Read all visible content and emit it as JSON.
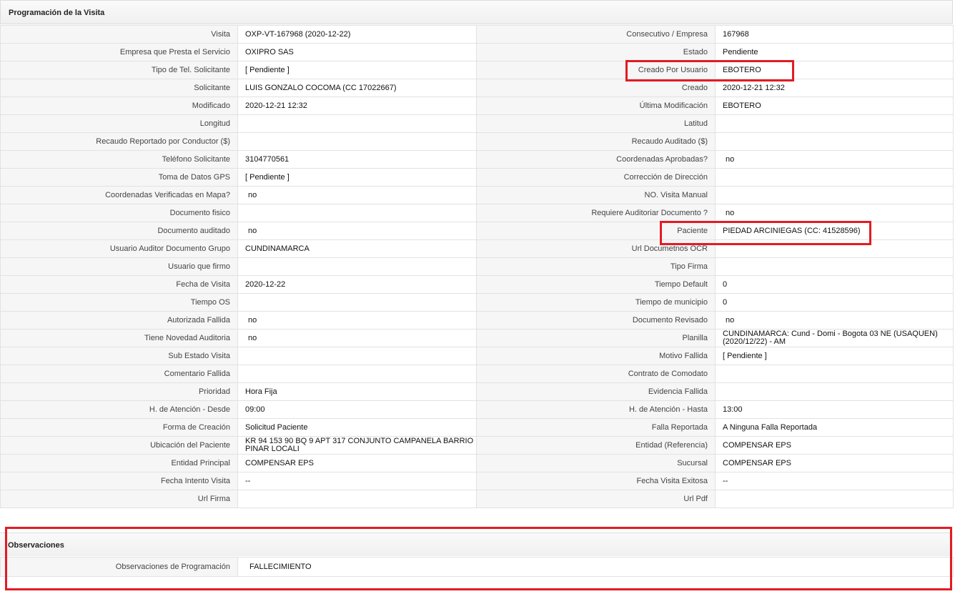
{
  "section_title": "Programación de la Visita",
  "rows": [
    {
      "l1": "Visita",
      "v1": "OXP-VT-167968 (2020-12-22)",
      "l2": "Consecutivo / Empresa",
      "v2": "167968"
    },
    {
      "l1": "Empresa que Presta el Servicio",
      "v1": "OXIPRO SAS",
      "l2": "Estado",
      "v2": "Pendiente"
    },
    {
      "l1": "Tipo de Tel. Solicitante",
      "v1": "[ Pendiente ]",
      "l2": "Creado Por Usuario",
      "v2": "EBOTERO"
    },
    {
      "l1": "Solicitante",
      "v1": "LUIS GONZALO COCOMA (CC 17022667)",
      "l2": "Creado",
      "v2": "2020-12-21 12:32"
    },
    {
      "l1": "Modificado",
      "v1": "2020-12-21 12:32",
      "l2": "Última Modificación",
      "v2": "EBOTERO"
    },
    {
      "l1": "Longitud",
      "v1": "",
      "l2": "Latitud",
      "v2": ""
    },
    {
      "l1": "Recaudo Reportado por Conductor ($)",
      "v1": "",
      "l2": "Recaudo Auditado ($)",
      "v2": ""
    },
    {
      "l1": "Teléfono Solicitante",
      "v1": "3104770561",
      "l2": "Coordenadas Aprobadas?",
      "v2": "no"
    },
    {
      "l1": "Toma de Datos GPS",
      "v1": "[ Pendiente ]",
      "l2": "Corrección de Dirección",
      "v2": ""
    },
    {
      "l1": "Coordenadas Verificadas en Mapa?",
      "v1": "no",
      "l2": "NO. Visita Manual",
      "v2": ""
    },
    {
      "l1": "Documento fisico",
      "v1": "",
      "l2": "Requiere Auditoriar Documento ?",
      "v2": "no"
    },
    {
      "l1": "Documento auditado",
      "v1": "no",
      "l2": "Paciente",
      "v2": "PIEDAD ARCINIEGAS (CC: 41528596)"
    },
    {
      "l1": "Usuario Auditor Documento Grupo",
      "v1": "CUNDINAMARCA",
      "l2": "Url Documetnos OCR",
      "v2": ""
    },
    {
      "l1": "Usuario que firmo",
      "v1": "",
      "l2": "Tipo Firma",
      "v2": ""
    },
    {
      "l1": "Fecha de Visita",
      "v1": "2020-12-22",
      "l2": "Tiempo Default",
      "v2": "0"
    },
    {
      "l1": "Tiempo OS",
      "v1": "",
      "l2": "Tiempo de municipio",
      "v2": "0"
    },
    {
      "l1": "Autorizada Fallida",
      "v1": "no",
      "l2": "Documento Revisado",
      "v2": "no"
    },
    {
      "l1": "Tiene Novedad Auditoria",
      "v1": "no",
      "l2": "Planilla",
      "v2": "CUNDINAMARCA: Cund - Domi - Bogota 03 NE (USAQUEN) (2020/12/22) - AM"
    },
    {
      "l1": "Sub Estado Visita",
      "v1": "",
      "l2": "Motivo Fallida",
      "v2": "[ Pendiente ]"
    },
    {
      "l1": "Comentario Fallida",
      "v1": "",
      "l2": "Contrato de Comodato",
      "v2": ""
    },
    {
      "l1": "Prioridad",
      "v1": "Hora Fija",
      "l2": "Evidencia Fallida",
      "v2": ""
    },
    {
      "l1": "H. de Atención - Desde",
      "v1": "09:00",
      "l2": "H. de Atención - Hasta",
      "v2": "13:00"
    },
    {
      "l1": "Forma de Creación",
      "v1": "Solicitud Paciente",
      "l2": "Falla Reportada",
      "v2": "A Ninguna Falla Reportada"
    },
    {
      "l1": "Ubicación del Paciente",
      "v1": "KR 94 153 90 BQ 9 APT 317 CONJUNTO CAMPANELA BARRIO PINAR LOCALI",
      "l2": "Entidad (Referencia)",
      "v2": "COMPENSAR EPS"
    },
    {
      "l1": "Entidad Principal",
      "v1": "COMPENSAR EPS",
      "l2": "Sucursal",
      "v2": "COMPENSAR EPS"
    },
    {
      "l1": "Fecha Intento Visita",
      "v1": "--",
      "l2": "Fecha Visita Exitosa",
      "v2": "--"
    },
    {
      "l1": "Url Firma",
      "v1": "",
      "l2": "Url Pdf",
      "v2": ""
    }
  ],
  "observaciones": {
    "title": "Observaciones",
    "label": "Observaciones de Programación",
    "value": "FALLECIMIENTO"
  },
  "highlight_color": "#e31b23"
}
